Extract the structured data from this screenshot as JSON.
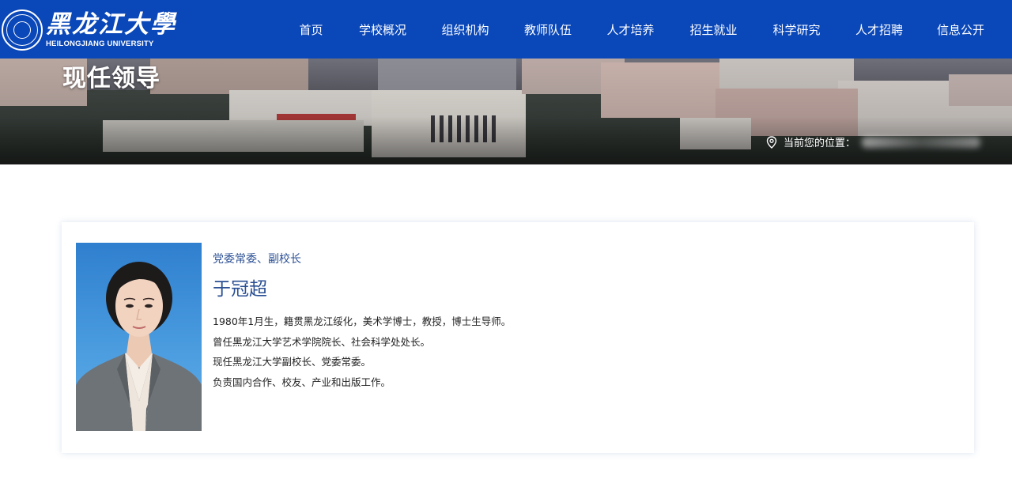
{
  "header": {
    "logo_cn": "黑龙江大學",
    "logo_en": "HEILONGJIANG UNIVERSITY",
    "nav": [
      {
        "label": "首页"
      },
      {
        "label": "学校概况"
      },
      {
        "label": "组织机构"
      },
      {
        "label": "教师队伍"
      },
      {
        "label": "人才培养"
      },
      {
        "label": "招生就业"
      },
      {
        "label": "科学研究"
      },
      {
        "label": "人才招聘"
      },
      {
        "label": "信息公开"
      }
    ]
  },
  "banner": {
    "title": "现任领导",
    "breadcrumb_label": "当前您的位置："
  },
  "leader": {
    "position": "党委常委、副校长",
    "name": "于冠超",
    "bio": [
      "1980年1月生，籍贯黑龙江绥化，美术学博士，教授，博士生导师。",
      "曾任黑龙江大学艺术学院院长、社会科学处处长。",
      "现任黑龙江大学副校长、党委常委。",
      "负责国内合作、校友、产业和出版工作。"
    ]
  },
  "colors": {
    "header_bg": "#0a47b8",
    "accent_text": "#2a4f93",
    "body_text": "#222222"
  },
  "icons": {
    "location": "location-pin-icon"
  }
}
